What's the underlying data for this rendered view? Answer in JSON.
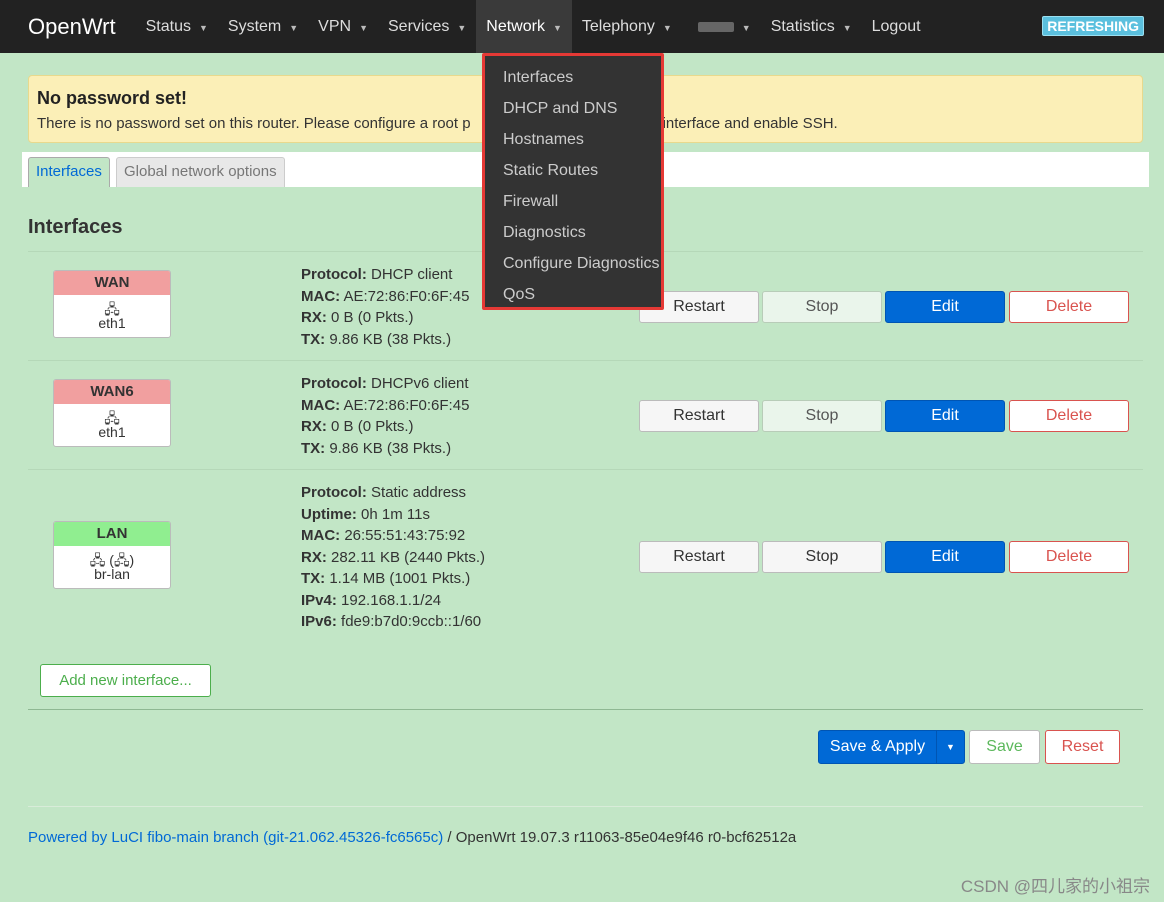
{
  "navbar": {
    "brand": "OpenWrt",
    "items": [
      {
        "label": "Status"
      },
      {
        "label": "System"
      },
      {
        "label": "VPN"
      },
      {
        "label": "Services"
      },
      {
        "label": "Network"
      },
      {
        "label": "Telephony"
      },
      {
        "label": ""
      },
      {
        "label": "Statistics"
      },
      {
        "label": "Logout"
      }
    ],
    "status_badge": "REFRESHING"
  },
  "network_menu": [
    "Interfaces",
    "DHCP and DNS",
    "Hostnames",
    "Static Routes",
    "Firewall",
    "Diagnostics",
    "Configure Diagnostics",
    "QoS"
  ],
  "alert": {
    "title": "No password set!",
    "text_before": "There is no password set on this router. Please configure a root p",
    "text_after": "interface and enable SSH."
  },
  "tabs": [
    "Interfaces",
    "Global network options"
  ],
  "section_title": "Interfaces",
  "interfaces": [
    {
      "name": "WAN",
      "device": "eth1",
      "details": [
        {
          "k": "Protocol:",
          "v": "DHCP client"
        },
        {
          "k": "MAC:",
          "v": "AE:72:86:F0:6F:45"
        },
        {
          "k": "RX:",
          "v": "0 B (0 Pkts.)"
        },
        {
          "k": "TX:",
          "v": "9.86 KB (38 Pkts.)"
        }
      ]
    },
    {
      "name": "WAN6",
      "device": "eth1",
      "details": [
        {
          "k": "Protocol:",
          "v": "DHCPv6 client"
        },
        {
          "k": "MAC:",
          "v": "AE:72:86:F0:6F:45"
        },
        {
          "k": "RX:",
          "v": "0 B (0 Pkts.)"
        },
        {
          "k": "TX:",
          "v": "9.86 KB (38 Pkts.)"
        }
      ]
    },
    {
      "name": "LAN",
      "device": "br-lan",
      "details": [
        {
          "k": "Protocol:",
          "v": "Static address"
        },
        {
          "k": "Uptime:",
          "v": "0h 1m 11s"
        },
        {
          "k": "MAC:",
          "v": "26:55:51:43:75:92"
        },
        {
          "k": "RX:",
          "v": "282.11 KB (2440 Pkts.)"
        },
        {
          "k": "TX:",
          "v": "1.14 MB (1001 Pkts.)"
        },
        {
          "k": "IPv4:",
          "v": "192.168.1.1/24"
        },
        {
          "k": "IPv6:",
          "v": "fde9:b7d0:9ccb::1/60"
        }
      ]
    }
  ],
  "row_buttons": {
    "restart": "Restart",
    "stop": "Stop",
    "edit": "Edit",
    "delete": "Delete"
  },
  "add_interface": "Add new interface...",
  "actions": {
    "save_apply": "Save & Apply",
    "save": "Save",
    "reset": "Reset"
  },
  "footer": {
    "link": "Powered by LuCI fibo-main branch (git-21.062.45326-fc6565c)",
    "rest": " / OpenWrt 19.07.3 r11063-85e04e9f46 r0-bcf62512a"
  },
  "watermark": "CSDN @四儿家的小祖宗"
}
